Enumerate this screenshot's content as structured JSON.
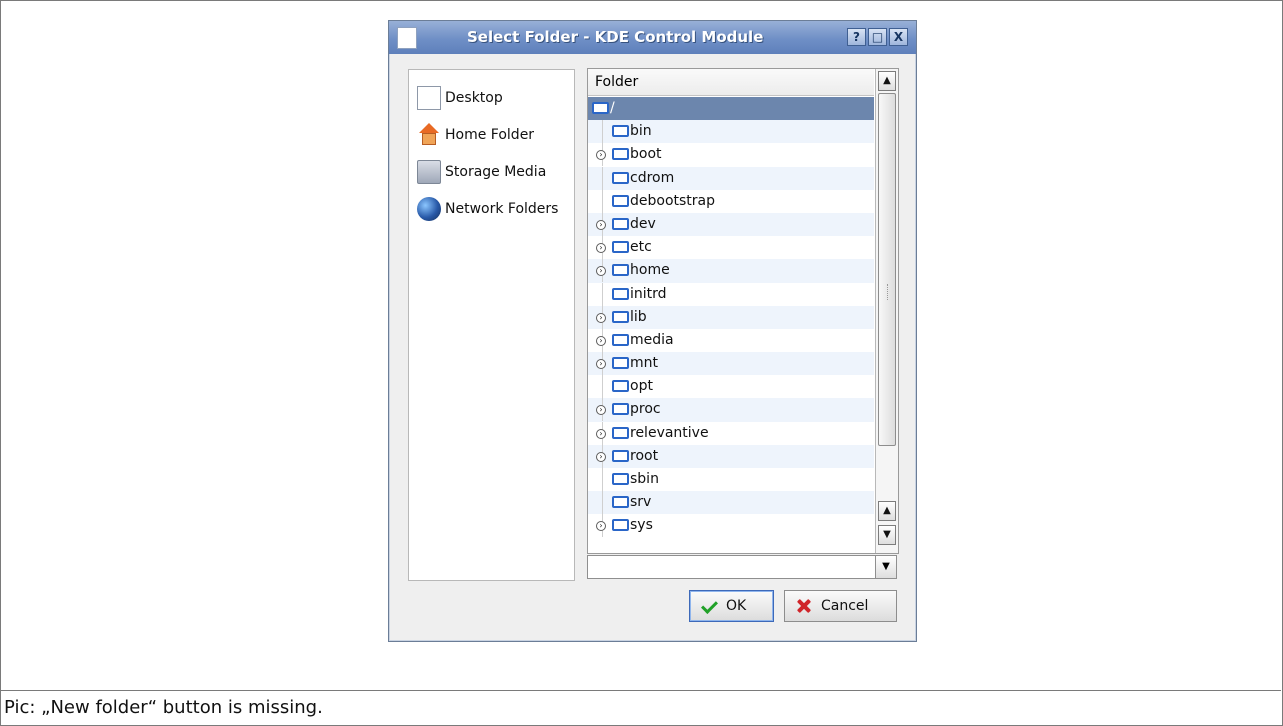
{
  "dialog": {
    "title": "Select Folder - KDE Control Module",
    "title_buttons": [
      "?",
      "□",
      "X"
    ],
    "places": [
      {
        "label": "Desktop",
        "icon": "desktop-icon"
      },
      {
        "label": "Home Folder",
        "icon": "home-folder-icon"
      },
      {
        "label": "Storage Media",
        "icon": "storage-media-icon"
      },
      {
        "label": "Network Folders",
        "icon": "network-folders-icon"
      }
    ],
    "tree_header": "Folder",
    "folders": [
      {
        "label": "/",
        "expandable": false,
        "selected": true
      },
      {
        "label": "bin",
        "expandable": false
      },
      {
        "label": "boot",
        "expandable": true
      },
      {
        "label": "cdrom",
        "expandable": false
      },
      {
        "label": "debootstrap",
        "expandable": false
      },
      {
        "label": "dev",
        "expandable": true
      },
      {
        "label": "etc",
        "expandable": true
      },
      {
        "label": "home",
        "expandable": true
      },
      {
        "label": "initrd",
        "expandable": false
      },
      {
        "label": "lib",
        "expandable": true
      },
      {
        "label": "media",
        "expandable": true
      },
      {
        "label": "mnt",
        "expandable": true
      },
      {
        "label": "opt",
        "expandable": false
      },
      {
        "label": "proc",
        "expandable": true
      },
      {
        "label": "relevantive",
        "expandable": true
      },
      {
        "label": "root",
        "expandable": true
      },
      {
        "label": "sbin",
        "expandable": false
      },
      {
        "label": "srv",
        "expandable": false
      },
      {
        "label": "sys",
        "expandable": true
      }
    ],
    "path_combo_value": "",
    "ok_label": "OK",
    "cancel_label": "Cancel"
  },
  "caption": "Pic: „New folder“ button is missing."
}
